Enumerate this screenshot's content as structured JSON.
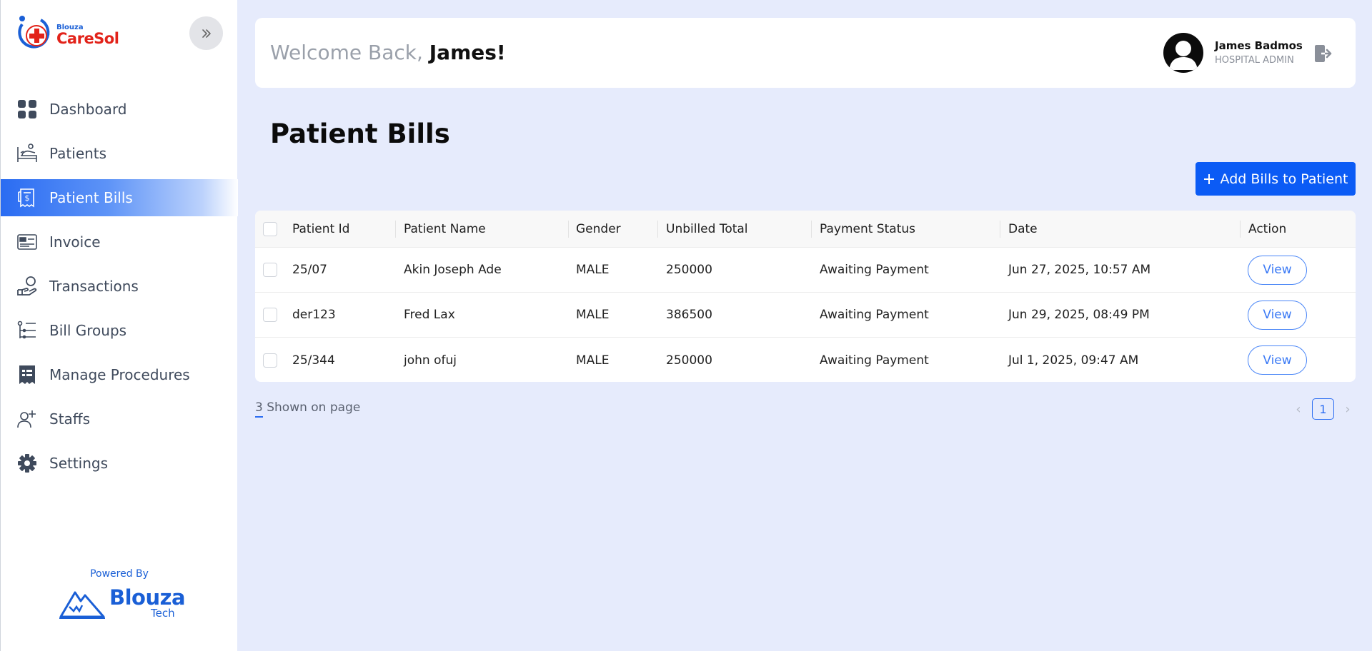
{
  "brand": {
    "small": "Blouza",
    "name": "CareSol",
    "icons": {
      "collapse": "chevrons-right-icon"
    }
  },
  "sidebar": {
    "items": [
      {
        "label": "Dashboard",
        "icon": "dashboard-grid-icon",
        "active": false
      },
      {
        "label": "Patients",
        "icon": "patient-bed-icon",
        "active": false
      },
      {
        "label": "Patient Bills",
        "icon": "bill-receipt-icon",
        "active": true
      },
      {
        "label": "Invoice",
        "icon": "invoice-icon",
        "active": false
      },
      {
        "label": "Transactions",
        "icon": "hand-coins-icon",
        "active": false
      },
      {
        "label": "Bill Groups",
        "icon": "list-groups-icon",
        "active": false
      },
      {
        "label": "Manage Procedures",
        "icon": "procedures-receipt-icon",
        "active": false
      },
      {
        "label": "Staffs",
        "icon": "staff-add-icon",
        "active": false
      },
      {
        "label": "Settings",
        "icon": "gear-icon",
        "active": false
      }
    ],
    "footer": {
      "powered_by": "Powered By",
      "brand_name": "Blouza",
      "brand_sub": "Tech"
    }
  },
  "header": {
    "welcome_prefix": "Welcome Back, ",
    "welcome_name": "James!",
    "user_name": "James Badmos",
    "user_role": "HOSPITAL ADMIN"
  },
  "page": {
    "title": "Patient Bills",
    "add_button": "Add Bills to Patient"
  },
  "table": {
    "headers": [
      "Patient Id",
      "Patient Name",
      "Gender",
      "Unbilled Total",
      "Payment Status",
      "Date",
      "Action"
    ],
    "rows": [
      {
        "id": "25/07",
        "name": "Akin Joseph Ade",
        "gender": "MALE",
        "total": "250000",
        "status": "Awaiting Payment",
        "date": "Jun 27, 2025, 10:57 AM",
        "action": "View"
      },
      {
        "id": "der123",
        "name": "Fred Lax",
        "gender": "MALE",
        "total": "386500",
        "status": "Awaiting Payment",
        "date": "Jun 29, 2025, 08:49 PM",
        "action": "View"
      },
      {
        "id": "25/344",
        "name": "john ofuj",
        "gender": "MALE",
        "total": "250000",
        "status": "Awaiting Payment",
        "date": "Jul 1, 2025, 09:47 AM",
        "action": "View"
      }
    ]
  },
  "pagination": {
    "shown_count": "3",
    "shown_label": " Shown on page",
    "current_page": "1",
    "prev": "‹",
    "next": "›"
  },
  "colors": {
    "accent": "#0b5bf5",
    "background": "#e6ebfc",
    "logo_red": "#e2231a"
  }
}
